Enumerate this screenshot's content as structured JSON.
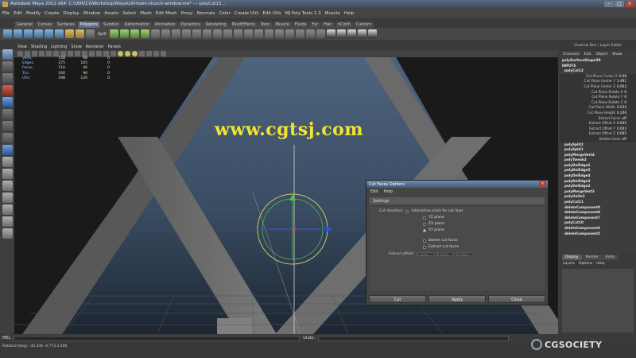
{
  "app": {
    "title": "Autodesk Maya 2012 x64: C:\\UDK\\CGWorkshop\\Maya\\clif-town-church-window.ma* --- polyCut12..."
  },
  "menubar": [
    "File",
    "Edit",
    "Modify",
    "Create",
    "Display",
    "Window",
    "Assets",
    "Select",
    "Mesh",
    "Edit Mesh",
    "Proxy",
    "Normals",
    "Color",
    "Create UVs",
    "Edit UVs",
    "MJ Poly Tools 1.3",
    "Muscle",
    "Help"
  ],
  "shelf": {
    "tabs": [
      "General",
      "Curves",
      "Surfaces",
      "Polygons",
      "Subdivs",
      "Deformation",
      "Animation",
      "Dynamics",
      "Rendering",
      "PaintEffects",
      "Toon",
      "Muscle",
      "Fluids",
      "Fur",
      "Hair",
      "nCloth",
      "Custom"
    ],
    "active_tab": "Polygons",
    "split_label": "Split"
  },
  "viewport": {
    "menu": [
      "View",
      "Shading",
      "Lighting",
      "Show",
      "Renderer",
      "Panels"
    ],
    "hud": [
      {
        "label": "Verts:",
        "a": "158",
        "b": "68",
        "c": "0"
      },
      {
        "label": "Edges:",
        "a": "275",
        "b": "105",
        "c": "0"
      },
      {
        "label": "Faces:",
        "a": "116",
        "b": "46",
        "c": "0"
      },
      {
        "label": "Tris:",
        "a": "240",
        "b": "96",
        "c": "0"
      },
      {
        "label": "UVs:",
        "a": "298",
        "b": "120",
        "c": "0"
      }
    ]
  },
  "watermark": "www.cgtsj.com",
  "dialog": {
    "title": "Cut Faces Options",
    "close": "×",
    "menu": [
      "Edit",
      "Help"
    ],
    "section": "Settings",
    "cut_direction_label": "Cut direction:",
    "options": [
      "Interactive (click for cut line)",
      "YZ plane",
      "ZX plane",
      "XY plane"
    ],
    "selected_option": "XY plane",
    "delete_cut_faces": "Delete cut faces",
    "extract_cut_faces": "Extract cut faces",
    "extract_offset_label": "Extract offset:",
    "extract_offset_values": [
      "0.5000",
      "0.5000",
      "0.5000"
    ],
    "buttons": {
      "cut": "Cut",
      "apply": "Apply",
      "close": "Close"
    }
  },
  "channel_box": {
    "header": "Channel Box / Layer Editor",
    "menu": [
      "Channels",
      "Edit",
      "Object",
      "Show"
    ],
    "shape": "polySurfaceShape50",
    "inputs_label": "INPUTS",
    "active_node": "polyCut12",
    "attributes": [
      {
        "name": "Cut Plane Center X",
        "value": "0.08"
      },
      {
        "name": "Cut Plane Center Y",
        "value": "1.491"
      },
      {
        "name": "Cut Plane Center Z",
        "value": "0.063"
      },
      {
        "name": "Cut Plane Rotate X",
        "value": "0"
      },
      {
        "name": "Cut Plane Rotate Y",
        "value": "0"
      },
      {
        "name": "Cut Plane Rotate Z",
        "value": "0"
      },
      {
        "name": "Cut Plane Width",
        "value": "0.034"
      },
      {
        "name": "Cut Plane Height",
        "value": "0.206"
      },
      {
        "name": "Extract Faces",
        "value": "off"
      },
      {
        "name": "Extract Offset X",
        "value": "0.005"
      },
      {
        "name": "Extract Offset Y",
        "value": "0.003"
      },
      {
        "name": "Extract Offset Z",
        "value": "0.005"
      },
      {
        "name": "Delete Faces",
        "value": "off"
      }
    ],
    "history": [
      "polySplit2",
      "polySplit1",
      "polyMergeVert4",
      "polyTweak2",
      "polyDelEdge6",
      "polyDelEdge5",
      "polyDelEdge4",
      "polyDelEdge3",
      "polyDelEdge2",
      "polyMergeVert3",
      "polyUnite1",
      "polyCut11",
      "deleteComponent9",
      "deleteComponent8",
      "deleteComponent7",
      "polyCut10",
      "deleteComponent6",
      "deleteComponent5"
    ]
  },
  "layers": {
    "tabs": [
      "Display",
      "Render",
      "Anim"
    ],
    "active_tab": "Display",
    "menu": [
      "Layers",
      "Options",
      "Help"
    ]
  },
  "timebar": {
    "mel_label": "MEL",
    "undo_label": "Undo:"
  },
  "helpline": {
    "text": "Rotation(deg):  -35.346   -4.773   2.406"
  },
  "brand": {
    "logo_text": "CGSOCIETY",
    "accent": "#f2e530"
  }
}
